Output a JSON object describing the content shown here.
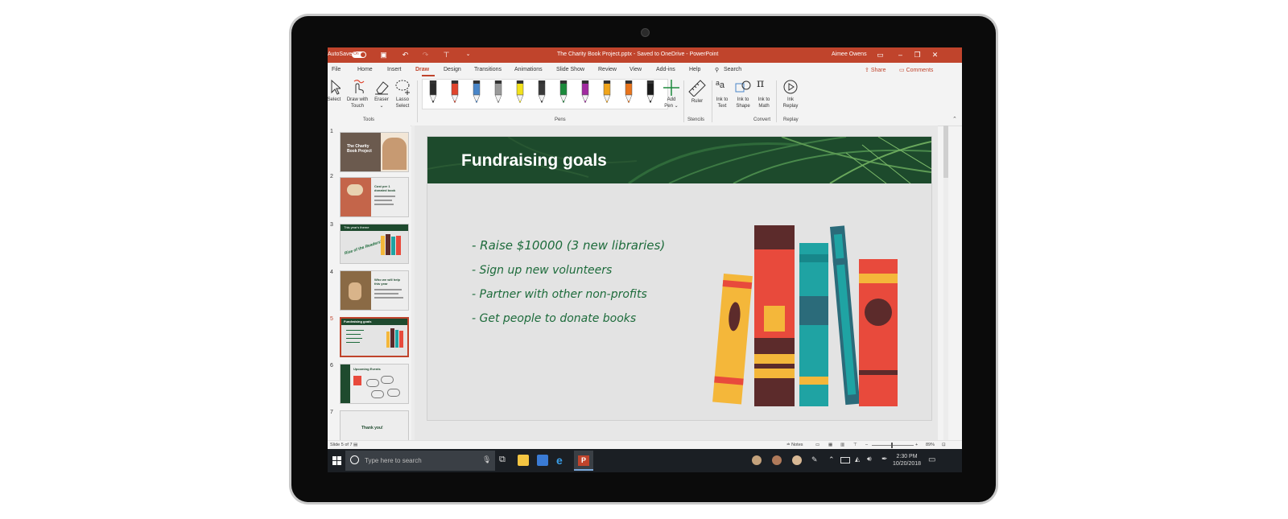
{
  "titlebar": {
    "autosave_label": "AutoSave",
    "autosave_state": "On",
    "document_title": "The Charity Book Project.pptx - Saved to OneDrive - PowerPoint",
    "user_name": "Aimee Owens"
  },
  "tabs": [
    "File",
    "Home",
    "Insert",
    "Draw",
    "Design",
    "Transitions",
    "Animations",
    "Slide Show",
    "Review",
    "View",
    "Add-ins",
    "Help"
  ],
  "active_tab": "Draw",
  "search_label": "Search",
  "share_label": "Share",
  "comments_label": "Comments",
  "ribbon": {
    "tools": {
      "select": "Select",
      "draw_with_touch_1": "Draw with",
      "draw_with_touch_2": "Touch",
      "eraser": "Eraser",
      "lasso_1": "Lasso",
      "lasso_2": "Select",
      "group": "Tools"
    },
    "pens": {
      "group": "Pens",
      "colors": [
        "#2b2b2b",
        "#e0442c",
        "#4a86c8",
        "#9a9a9a",
        "#f2e11b",
        "#3a3a3a",
        "#1c8a3c",
        "#a12ba0",
        "#f0a51c",
        "#e8741c",
        "#1a1a1a"
      ],
      "add_pen_1": "Add",
      "add_pen_2": "Pen"
    },
    "stencils": {
      "ruler": "Ruler",
      "group": "Stencils"
    },
    "convert": {
      "ink_to_text_1": "Ink to",
      "ink_to_text_2": "Text",
      "ink_to_shape_1": "Ink to",
      "ink_to_shape_2": "Shape",
      "ink_to_math_1": "Ink to",
      "ink_to_math_2": "Math",
      "group": "Convert"
    },
    "replay": {
      "ink_replay_1": "Ink",
      "ink_replay_2": "Replay",
      "group": "Replay"
    }
  },
  "thumbnails": [
    {
      "num": "1",
      "title_1": "The Charity",
      "title_2": "Book Project"
    },
    {
      "num": "2",
      "title_1": "Cost per 1",
      "title_2": "donated book"
    },
    {
      "num": "3",
      "title_1": "This year's theme",
      "title_2": "Rise of the Readers!"
    },
    {
      "num": "4",
      "title_1": "Who we will help",
      "title_2": "this year"
    },
    {
      "num": "5",
      "title_1": "Fundraising goals",
      "title_2": ""
    },
    {
      "num": "6",
      "title_1": "Upcoming Events",
      "title_2": ""
    },
    {
      "num": "7",
      "title_1": "Thank you!",
      "title_2": ""
    }
  ],
  "active_slide": 5,
  "slide": {
    "title": "Fundraising goals",
    "bullets": [
      "- Raise $10000 (3 new libraries)",
      "- Sign up new volunteers",
      "- Partner with other non-profits",
      "- Get people to donate books"
    ]
  },
  "statusbar": {
    "slide_info": "Slide 5 of 7",
    "notes": "Notes",
    "zoom": "89%"
  },
  "taskbar": {
    "search_placeholder": "Type here to search",
    "time": "2:30 PM",
    "date": "10/20/2018"
  }
}
